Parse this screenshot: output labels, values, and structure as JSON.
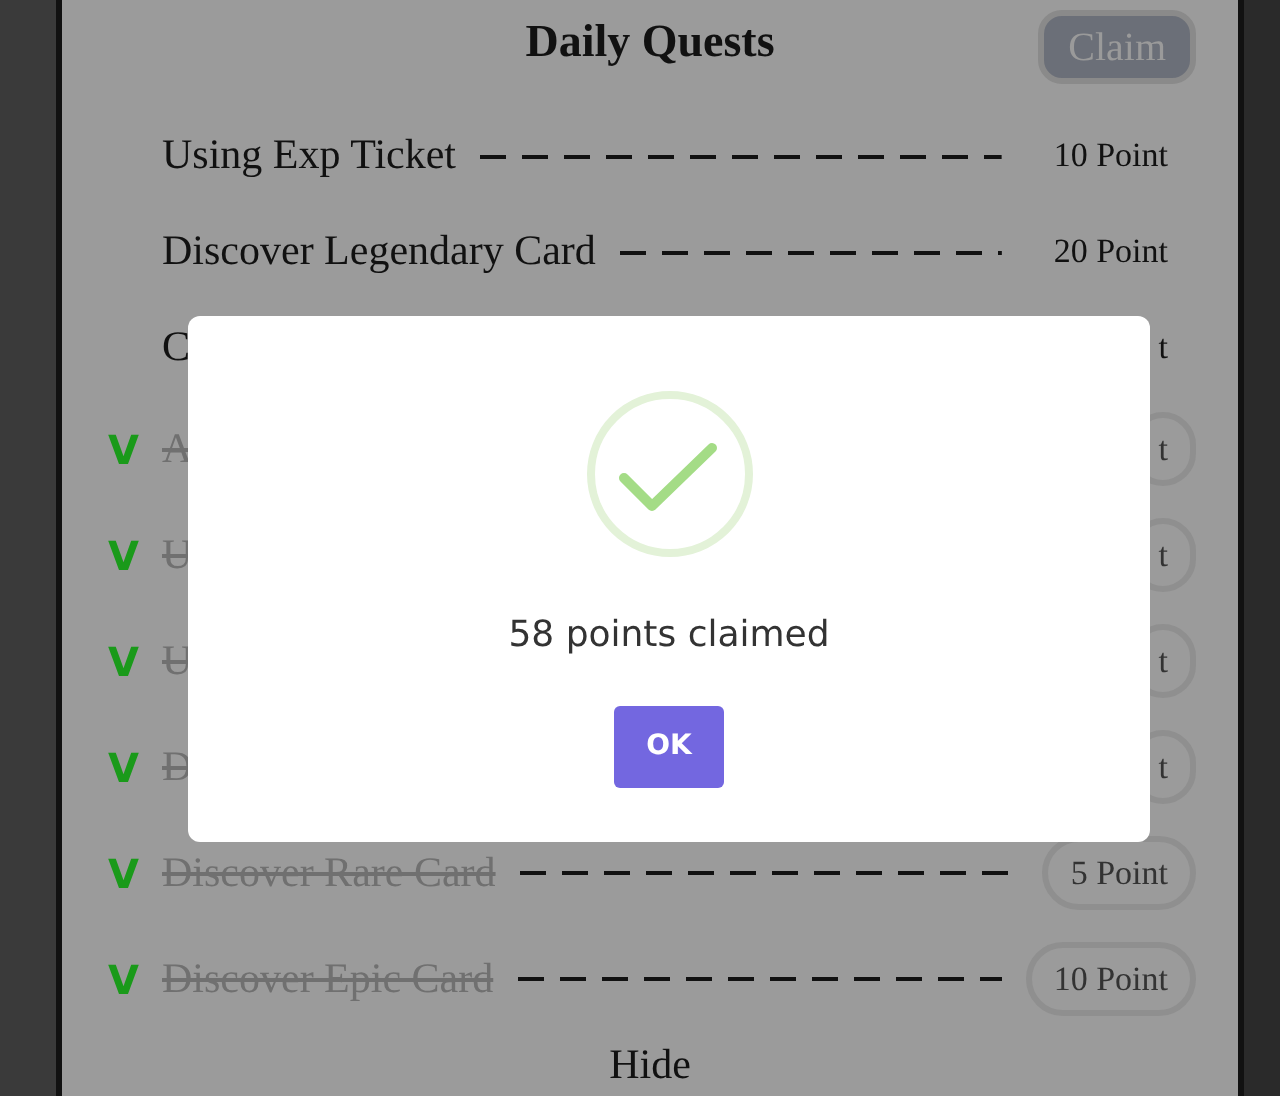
{
  "title": "Daily Quests",
  "claim_button": {
    "label": "Claim",
    "disabled": true
  },
  "quests": [
    {
      "label": "Using Exp Ticket",
      "points": "10 Point",
      "done": false,
      "leader": true
    },
    {
      "label": "Discover Legendary Card",
      "points": "20 Point",
      "done": false,
      "leader": true
    },
    {
      "label": "C",
      "points": "t",
      "done": false
    },
    {
      "mark": "V",
      "label": "A",
      "points": "t",
      "done": true
    },
    {
      "mark": "V",
      "label": "U",
      "points": "t",
      "done": true
    },
    {
      "mark": "V",
      "label": "U",
      "points": "t",
      "done": true
    },
    {
      "mark": "V",
      "label": "D",
      "points": "t",
      "done": true
    },
    {
      "mark": "V",
      "label": "Discover Rare Card",
      "points": "5 Point",
      "done": true,
      "leader": true
    },
    {
      "mark": "V",
      "label": "Discover Epic Card",
      "points": "10 Point",
      "done": true,
      "leader": true
    }
  ],
  "hide_link": "Hide",
  "dialog": {
    "message": "58 points claimed",
    "button": "OK"
  }
}
